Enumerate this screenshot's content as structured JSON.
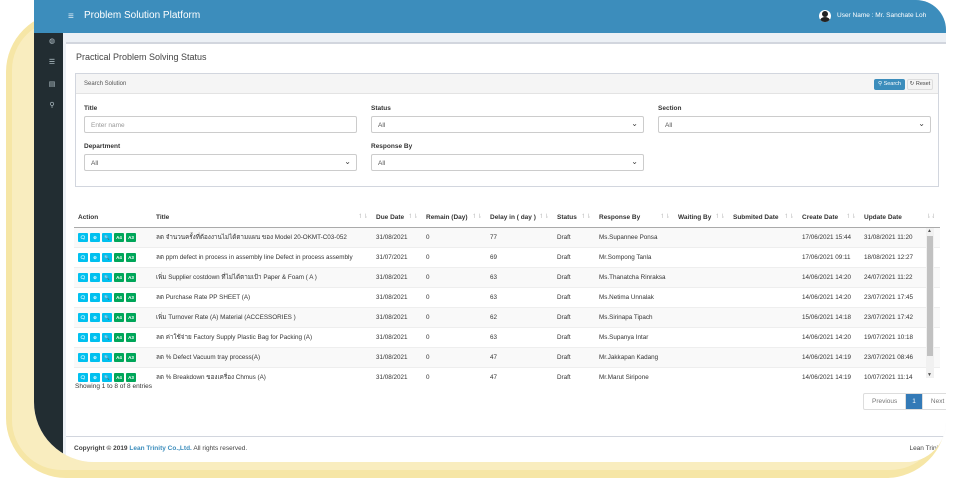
{
  "app": {
    "title": "Problem Solution Platform",
    "user": "User Name : Mr. Sanchate Loh"
  },
  "page": {
    "title": "Practical Problem Solving Status"
  },
  "search": {
    "heading": "Search Solution",
    "search_label": "Search",
    "reset_label": "Reset",
    "title_label": "Title",
    "title_placeholder": "Enter name",
    "status_label": "Status",
    "status_value": "All",
    "section_label": "Section",
    "section_value": "All",
    "department_label": "Department",
    "department_value": "All",
    "response_label": "Response By",
    "response_value": "All"
  },
  "table": {
    "headers": [
      "Action",
      "Title",
      "Due Date",
      "Remain (Day)",
      "Delay in ( day )",
      "Status",
      "Response By",
      "Waiting By",
      "Submited Date",
      "Create Date",
      "Update Date"
    ],
    "rows": [
      [
        "ลด จำนวนครั้งที่ต้องงานไม่ได้ตามแผน ของ Model 20-OKMT-C03-052",
        "31/08/2021",
        "0",
        "77",
        "Draft",
        "Ms.Supannee Ponsa",
        "",
        "",
        "17/06/2021 15:44",
        "31/08/2021 11:20"
      ],
      [
        "ลด ppm defect in process in assembly line Defect in process assembly",
        "31/07/2021",
        "0",
        "69",
        "Draft",
        "Mr.Sompong Tanla",
        "",
        "",
        "17/06/2021 09:11",
        "18/08/2021 12:27"
      ],
      [
        "เพิ่ม Supplier costdown ที่ไม่ได้ตามเป้า Paper & Foam ( A )",
        "31/08/2021",
        "0",
        "63",
        "Draft",
        "Ms.Thanatcha Rinraksa",
        "",
        "",
        "14/06/2021 14:20",
        "24/07/2021 11:22"
      ],
      [
        "ลด Purchase Rate PP SHEET (A)",
        "31/08/2021",
        "0",
        "63",
        "Draft",
        "Ms.Netima Unnalak",
        "",
        "",
        "14/06/2021 14:20",
        "23/07/2021 17:45"
      ],
      [
        "เพิ่ม Turnover Rate (A) Material (ACCESSORIES )",
        "31/08/2021",
        "0",
        "62",
        "Draft",
        "Ms.Sirinapa Tipach",
        "",
        "",
        "15/06/2021 14:18",
        "23/07/2021 17:42"
      ],
      [
        "ลด ค่าใช้จ่าย Factory Supply Plastic Bag for Packing (A)",
        "31/08/2021",
        "0",
        "63",
        "Draft",
        "Ms.Supanya Intar",
        "",
        "",
        "14/06/2021 14:20",
        "19/07/2021 10:18"
      ],
      [
        "ลด % Defect Vacuum tray process(A)",
        "31/08/2021",
        "0",
        "47",
        "Draft",
        "Mr.Jakkapan Kadang",
        "",
        "",
        "14/06/2021 14:19",
        "23/07/2021 08:46"
      ],
      [
        "ลด % Breakdown ของเครื่อง Chmus (A)",
        "31/08/2021",
        "0",
        "47",
        "Draft",
        "Mr.Marut Siripone",
        "",
        "",
        "14/06/2021 14:19",
        "10/07/2021 11:14"
      ]
    ],
    "action_buttons": [
      "🗨",
      "⊕",
      "🔍",
      "A4",
      "A3"
    ]
  },
  "entries_text": "Showing 1 to 8 of 8 entries",
  "pager": {
    "previous": "Previous",
    "page": "1",
    "next": "Next"
  },
  "footer": {
    "copy_prefix": "Copyright © 2019",
    "company": "Lean Trinity Co.,Ltd.",
    "copy_suffix": "All rights reserved.",
    "right": "Lean Trini"
  },
  "colors": {
    "topbar": "#3c8dbc",
    "sidebar": "#222d32",
    "action_blue": "#00c0ef",
    "action_green": "#00a65a"
  },
  "icons": {
    "menu": "hamburger-icon",
    "user": "user-avatar-icon",
    "sidebar": [
      "dashboard-icon",
      "list-icon",
      "document-icon",
      "search-icon"
    ]
  }
}
